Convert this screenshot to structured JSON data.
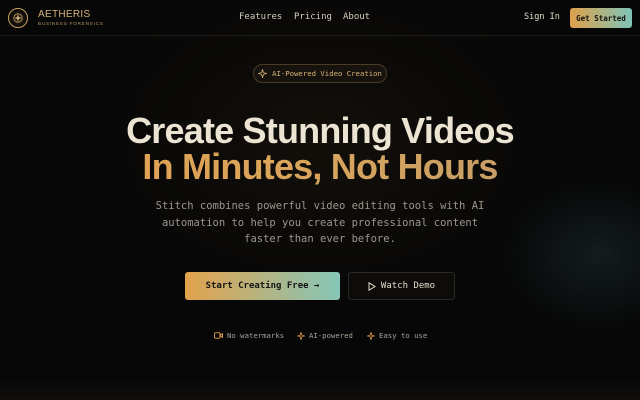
{
  "brand": {
    "name": "AETHERIS",
    "tagline": "BUSINESS FORENSICS"
  },
  "nav": {
    "items": [
      "Features",
      "Pricing",
      "About"
    ]
  },
  "header": {
    "sign_in": "Sign In",
    "get_started": "Get Started"
  },
  "hero": {
    "badge": "AI-Powered Video Creation",
    "badge_icon": "sparkles-icon",
    "title_line1": "Create Stunning Videos",
    "title_line2": "In Minutes, Not Hours",
    "subtitle_lines": [
      "Stitch combines powerful video editing tools with AI",
      "automation to help you create professional content",
      "faster than ever before."
    ],
    "primary_cta": "Start Creating Free →",
    "secondary_cta": "Watch Demo"
  },
  "features": [
    {
      "label": "No watermarks",
      "icon": "video-icon"
    },
    {
      "label": "AI-powered",
      "icon": "sparkles-icon"
    },
    {
      "label": "Easy to use",
      "icon": "sparkles-icon"
    }
  ],
  "colors": {
    "background": "#070707",
    "accent_orange": "#e3a24c",
    "accent_teal": "#86c6b8",
    "gold_text": "#d8b57a"
  }
}
